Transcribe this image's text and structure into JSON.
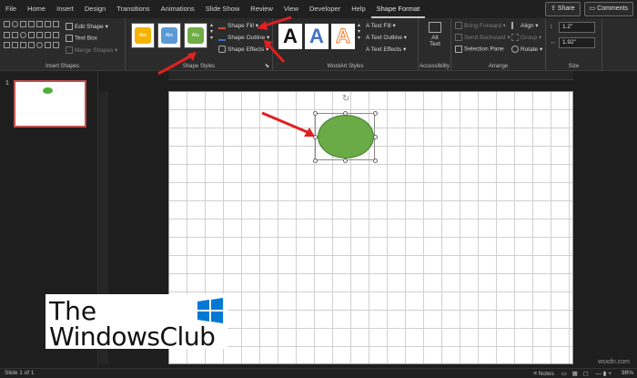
{
  "menu": {
    "tabs": [
      "File",
      "Home",
      "Insert",
      "Design",
      "Transitions",
      "Animations",
      "Slide Show",
      "Review",
      "View",
      "Developer",
      "Help",
      "Shape Format"
    ],
    "active_tab": "Shape Format",
    "share_label": "Share",
    "comments_label": "Comments"
  },
  "ribbon": {
    "insert_shapes": {
      "label": "Insert Shapes",
      "edit_shape": "Edit Shape",
      "text_box": "Text Box",
      "merge_shapes": "Merge Shapes"
    },
    "shape_styles": {
      "label": "Shape Styles",
      "presets": [
        {
          "text": "Abc",
          "color": "#f5b400"
        },
        {
          "text": "Abc",
          "color": "#5b9bd5"
        },
        {
          "text": "Abc",
          "color": "#70ad47"
        }
      ],
      "shape_fill": "Shape Fill",
      "shape_outline": "Shape Outline",
      "shape_effects": "Shape Effects"
    },
    "wordart_styles": {
      "label": "WordArt Styles",
      "presets": [
        "A",
        "A",
        "A"
      ],
      "text_fill": "Text Fill",
      "text_outline": "Text Outline",
      "text_effects": "Text Effects"
    },
    "accessibility": {
      "label": "Accessibility",
      "alt_text_line1": "Alt",
      "alt_text_line2": "Text"
    },
    "arrange": {
      "label": "Arrange",
      "bring_forward": "Bring Forward",
      "send_backward": "Send Backward",
      "selection_pane": "Selection Pane",
      "align": "Align",
      "group": "Group",
      "rotate": "Rotate"
    },
    "size": {
      "label": "Size",
      "height": "1.2\"",
      "width": "1.92\""
    }
  },
  "thumbnail": {
    "slide_number": "1"
  },
  "status": {
    "slide_info": "Slide 1 of 1",
    "notes": "Notes",
    "zoom": "98%"
  },
  "watermark": {
    "line1": "The",
    "line2": "WindowsClub"
  },
  "credit": "wsxdn.com",
  "colors": {
    "shape_fill": "#6aab47",
    "arrow": "#e02020"
  }
}
